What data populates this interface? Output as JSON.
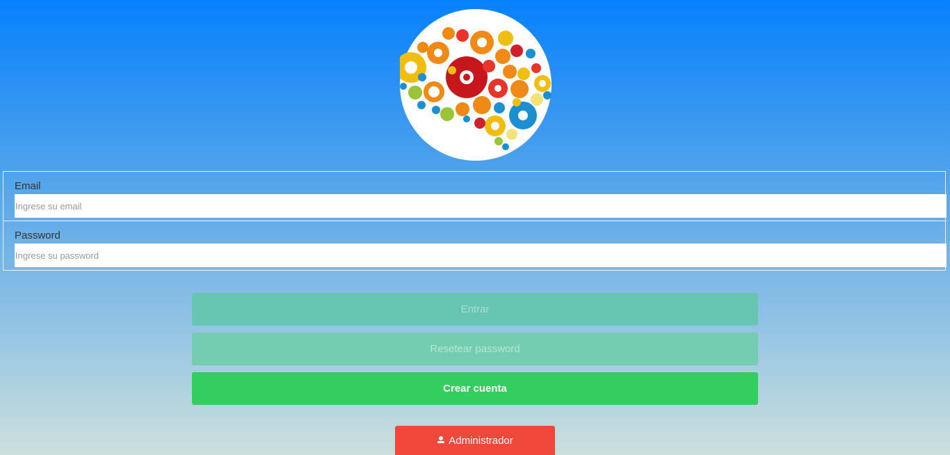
{
  "logo": {
    "icon": "brain-gears-icon"
  },
  "form": {
    "email": {
      "label": "Email",
      "placeholder": "Ingrese su email",
      "value": ""
    },
    "password": {
      "label": "Password",
      "placeholder": "Ingrese su password",
      "value": ""
    }
  },
  "buttons": {
    "entrar": "Entrar",
    "reset": "Resetear password",
    "crear": "Crear cuenta",
    "admin": "Administrador",
    "admin_icon": "user-icon"
  },
  "colors": {
    "bg_top": "#0781fe",
    "bg_bottom": "#cce0dc",
    "entrar": "#67c6b2",
    "reset": "#74cdb0",
    "crear": "#34ce60",
    "admin": "#f0483a"
  }
}
